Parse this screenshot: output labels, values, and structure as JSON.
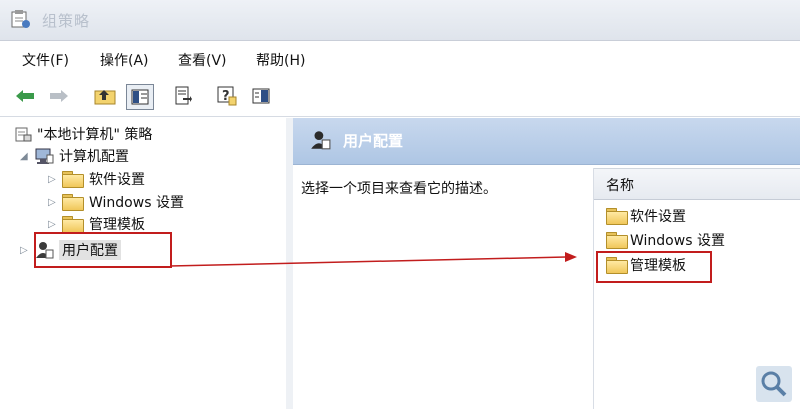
{
  "window": {
    "title": "组策略"
  },
  "menu": [
    {
      "label": "文件(F)"
    },
    {
      "label": "操作(A)"
    },
    {
      "label": "查看(V)"
    },
    {
      "label": "帮助(H)"
    }
  ],
  "toolbar": {
    "buttons": [
      "back-icon",
      "forward-icon",
      "up-folder-icon",
      "show-tree-icon",
      "export-icon",
      "help-icon",
      "pane-icon"
    ]
  },
  "tree": {
    "root": "\"本地计算机\" 策略",
    "computer_config": "计算机配置",
    "children": [
      "软件设置",
      "Windows 设置",
      "管理模板"
    ],
    "user_config": "用户配置"
  },
  "right_pane": {
    "header": "用户配置",
    "description": "选择一个项目来查看它的描述。",
    "column_name": "名称",
    "items": [
      "软件设置",
      "Windows 设置",
      "管理模板"
    ]
  },
  "colors": {
    "highlight_box": "#c21d1d",
    "header_blue": "#aec6e4"
  }
}
